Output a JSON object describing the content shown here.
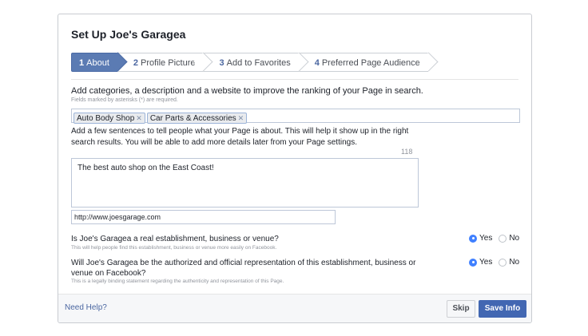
{
  "dialog": {
    "title": "Set Up Joe's Garagea",
    "steps": [
      {
        "num": "1",
        "label": "About"
      },
      {
        "num": "2",
        "label": "Profile Picture"
      },
      {
        "num": "3",
        "label": "Add to Favorites"
      },
      {
        "num": "4",
        "label": "Preferred Page Audience"
      }
    ],
    "active_step": 0
  },
  "about": {
    "intro": "Add categories, a description and a website to improve the ranking of your Page in search.",
    "required_note": "Fields marked by asterisks (*) are required.",
    "categories": [
      "Auto Body Shop",
      "Car Parts & Accessories"
    ],
    "description_help": "Add a few sentences to tell people what your Page is about. This will help it show up in the right search results. You will be able to add more details later from your Page settings.",
    "char_count": "118",
    "description_value": "The best auto shop on the East Coast!",
    "website_value": "http://www.joesgarage.com"
  },
  "questions": [
    {
      "text": "Is Joe's Garagea a real establishment, business or venue?",
      "sub": "This will help people find this establishment, business or venue more easily on Facebook.",
      "yes": "Yes",
      "no": "No",
      "selected": "Yes"
    },
    {
      "text": "Will Joe's Garagea be the authorized and official representation of this establishment, business or venue on Facebook?",
      "sub": "This is a legally binding statement regarding the authenticity and representation of this Page.",
      "yes": "Yes",
      "no": "No",
      "selected": "Yes"
    }
  ],
  "footer": {
    "help": "Need Help?",
    "skip": "Skip",
    "save": "Save Info"
  },
  "colors": {
    "accent": "#4267b2",
    "active_step": "#5b7bb3",
    "radio_on": "#4080ff"
  }
}
